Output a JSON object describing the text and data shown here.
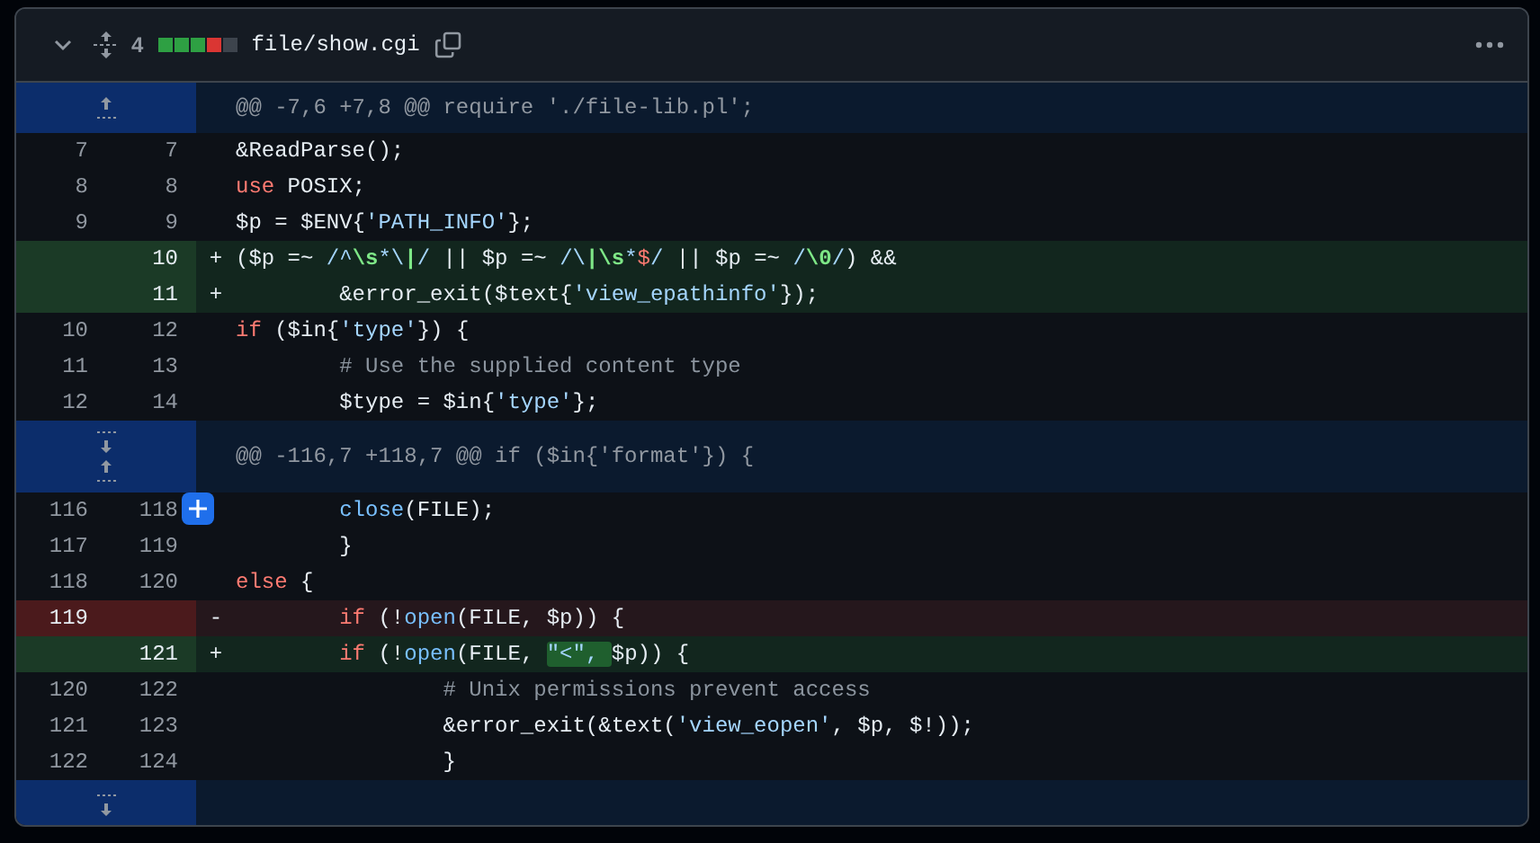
{
  "file_header": {
    "expanded": true,
    "changes": "4",
    "diffstat": [
      {
        "kind": "added"
      },
      {
        "kind": "added"
      },
      {
        "kind": "added"
      },
      {
        "kind": "removed"
      },
      {
        "kind": "neutral"
      }
    ],
    "path": "file/show.cgi"
  },
  "rows": [
    {
      "kind": "hunk",
      "expanders": [
        {
          "kind": "up"
        }
      ],
      "header": "@@ -7,6 +7,8 @@ require './file-lib.pl';"
    },
    {
      "kind": "context",
      "old": "7",
      "new": "7",
      "code": [
        {
          "kind": "plain",
          "text": "&ReadParse();"
        }
      ]
    },
    {
      "kind": "context",
      "old": "8",
      "new": "8",
      "code": [
        {
          "kind": "keyword",
          "text": "use"
        },
        {
          "kind": "plain",
          "text": " POSIX;"
        }
      ]
    },
    {
      "kind": "context",
      "old": "9",
      "new": "9",
      "code": [
        {
          "kind": "plain",
          "text": "$p = $ENV{"
        },
        {
          "kind": "string",
          "text": "'PATH_INFO'"
        },
        {
          "kind": "plain",
          "text": "};"
        }
      ]
    },
    {
      "kind": "add",
      "new": "10",
      "marker": "+",
      "code": [
        {
          "kind": "plain",
          "text": "($p =~ "
        },
        {
          "kind": "string",
          "text": "/^"
        },
        {
          "kind": "regex",
          "text": "\\s"
        },
        {
          "kind": "string",
          "text": "*\\"
        },
        {
          "kind": "regex",
          "text": "|"
        },
        {
          "kind": "string",
          "text": "/"
        },
        {
          "kind": "plain",
          "text": " || $p =~ "
        },
        {
          "kind": "string",
          "text": "/\\"
        },
        {
          "kind": "regex",
          "text": "|\\s"
        },
        {
          "kind": "string",
          "text": "*"
        },
        {
          "kind": "keyword",
          "text": "$"
        },
        {
          "kind": "string",
          "text": "/"
        },
        {
          "kind": "plain",
          "text": " || $p =~ "
        },
        {
          "kind": "string",
          "text": "/"
        },
        {
          "kind": "regex",
          "text": "\\0"
        },
        {
          "kind": "string",
          "text": "/"
        },
        {
          "kind": "plain",
          "text": ") &&"
        }
      ]
    },
    {
      "kind": "add",
      "new": "11",
      "marker": "+",
      "code": [
        {
          "kind": "plain",
          "text": "        &error_exit($text{"
        },
        {
          "kind": "string",
          "text": "'view_epathinfo'"
        },
        {
          "kind": "plain",
          "text": "});"
        }
      ]
    },
    {
      "kind": "context",
      "old": "10",
      "new": "12",
      "code": [
        {
          "kind": "keyword",
          "text": "if"
        },
        {
          "kind": "plain",
          "text": " ($in{"
        },
        {
          "kind": "string",
          "text": "'type'"
        },
        {
          "kind": "plain",
          "text": "}) {"
        }
      ]
    },
    {
      "kind": "context",
      "old": "11",
      "new": "13",
      "code": [
        {
          "kind": "comment",
          "text": "        # Use the supplied content type"
        }
      ]
    },
    {
      "kind": "context",
      "old": "12",
      "new": "14",
      "code": [
        {
          "kind": "plain",
          "text": "        $type = $in{"
        },
        {
          "kind": "string",
          "text": "'type'"
        },
        {
          "kind": "plain",
          "text": "};"
        }
      ]
    },
    {
      "kind": "hunk",
      "expanders": [
        {
          "kind": "down"
        },
        {
          "kind": "up"
        }
      ],
      "header": "@@ -116,7 +118,7 @@ if ($in{'format'}) {"
    },
    {
      "kind": "context",
      "old": "116",
      "new": "118",
      "comment_button": true,
      "code": [
        {
          "kind": "function",
          "text": "        close"
        },
        {
          "kind": "plain",
          "text": "(FILE);"
        }
      ]
    },
    {
      "kind": "context",
      "old": "117",
      "new": "119",
      "code": [
        {
          "kind": "plain",
          "text": "        }"
        }
      ]
    },
    {
      "kind": "context",
      "old": "118",
      "new": "120",
      "code": [
        {
          "kind": "keyword",
          "text": "else"
        },
        {
          "kind": "plain",
          "text": " {"
        }
      ]
    },
    {
      "kind": "del",
      "old": "119",
      "marker": "-",
      "code": [
        {
          "kind": "keyword",
          "text": "        if"
        },
        {
          "kind": "plain",
          "text": " (!"
        },
        {
          "kind": "function",
          "text": "open"
        },
        {
          "kind": "plain",
          "text": "(FILE, $p)) {"
        }
      ]
    },
    {
      "kind": "add",
      "new": "121",
      "marker": "+",
      "code": [
        {
          "kind": "keyword",
          "text": "        if"
        },
        {
          "kind": "plain",
          "text": " (!"
        },
        {
          "kind": "function",
          "text": "open"
        },
        {
          "kind": "plain",
          "text": "(FILE, "
        },
        {
          "kind": "inserted",
          "text": "\"<\", "
        },
        {
          "kind": "plain",
          "text": "$p)) {"
        }
      ]
    },
    {
      "kind": "context",
      "old": "120",
      "new": "122",
      "code": [
        {
          "kind": "comment",
          "text": "                # Unix permissions prevent access"
        }
      ]
    },
    {
      "kind": "context",
      "old": "121",
      "new": "123",
      "code": [
        {
          "kind": "plain",
          "text": "                &error_exit(&text("
        },
        {
          "kind": "string",
          "text": "'view_eopen'"
        },
        {
          "kind": "plain",
          "text": ", $p, $!));"
        }
      ]
    },
    {
      "kind": "context",
      "old": "122",
      "new": "124",
      "code": [
        {
          "kind": "plain",
          "text": "                }"
        }
      ]
    },
    {
      "kind": "hunk",
      "expanders": [
        {
          "kind": "down"
        }
      ]
    }
  ]
}
